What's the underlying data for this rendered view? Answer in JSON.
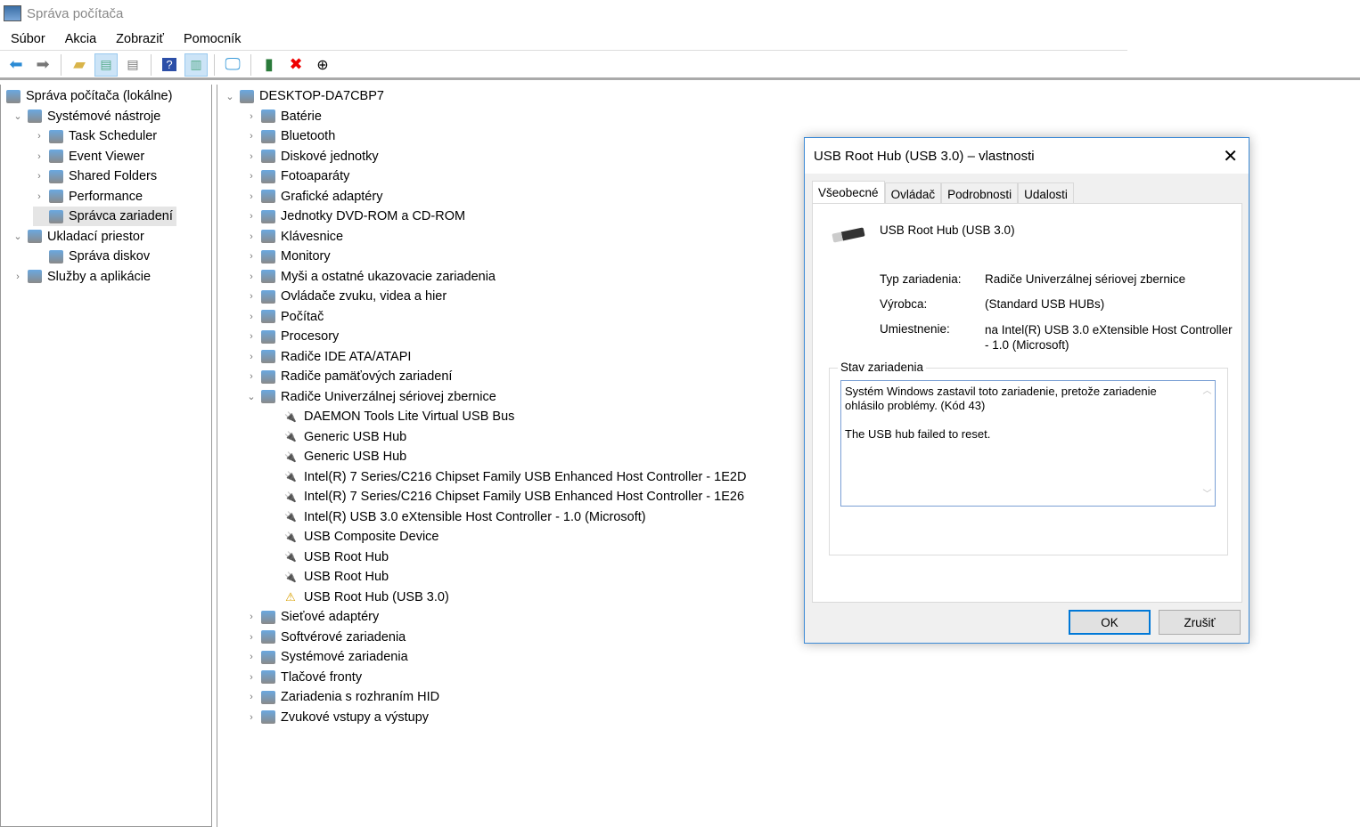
{
  "window": {
    "title": "Správa počítača"
  },
  "menu": [
    "Súbor",
    "Akcia",
    "Zobraziť",
    "Pomocník"
  ],
  "toolbar": [
    "back-icon",
    "forward-icon",
    "up-folder-icon",
    "show-hide-tree-icon",
    "properties-icon",
    "help-icon",
    "show-action-pane-icon",
    "monitor-icon",
    "update-driver-icon",
    "uninstall-icon",
    "disable-icon"
  ],
  "left_tree": [
    {
      "label": "Správa počítača (lokálne)",
      "level": 0,
      "chev": ""
    },
    {
      "label": "Systémové nástroje",
      "level": 1,
      "chev": "v"
    },
    {
      "label": "Task Scheduler",
      "level": 2,
      "chev": ">"
    },
    {
      "label": "Event Viewer",
      "level": 2,
      "chev": ">"
    },
    {
      "label": "Shared Folders",
      "level": 2,
      "chev": ">"
    },
    {
      "label": "Performance",
      "level": 2,
      "chev": ">"
    },
    {
      "label": "Správca zariadení",
      "level": 2,
      "chev": "",
      "selected": true
    },
    {
      "label": "Ukladací priestor",
      "level": 1,
      "chev": "v"
    },
    {
      "label": "Správa diskov",
      "level": 2,
      "chev": ""
    },
    {
      "label": "Služby a aplikácie",
      "level": 1,
      "chev": ">"
    }
  ],
  "device_tree": [
    {
      "label": "DESKTOP-DA7CBP7",
      "level": 0,
      "chev": "v"
    },
    {
      "label": "Batérie",
      "level": 1,
      "chev": ">"
    },
    {
      "label": "Bluetooth",
      "level": 1,
      "chev": ">"
    },
    {
      "label": "Diskové jednotky",
      "level": 1,
      "chev": ">"
    },
    {
      "label": "Fotoaparáty",
      "level": 1,
      "chev": ">"
    },
    {
      "label": "Grafické adaptéry",
      "level": 1,
      "chev": ">"
    },
    {
      "label": "Jednotky DVD-ROM a CD-ROM",
      "level": 1,
      "chev": ">"
    },
    {
      "label": "Klávesnice",
      "level": 1,
      "chev": ">"
    },
    {
      "label": "Monitory",
      "level": 1,
      "chev": ">"
    },
    {
      "label": "Myši a ostatné ukazovacie zariadenia",
      "level": 1,
      "chev": ">"
    },
    {
      "label": "Ovládače zvuku, videa a hier",
      "level": 1,
      "chev": ">"
    },
    {
      "label": "Počítač",
      "level": 1,
      "chev": ">"
    },
    {
      "label": "Procesory",
      "level": 1,
      "chev": ">"
    },
    {
      "label": "Radiče IDE ATA/ATAPI",
      "level": 1,
      "chev": ">"
    },
    {
      "label": "Radiče pamäťových zariadení",
      "level": 1,
      "chev": ">"
    },
    {
      "label": "Radiče Univerzálnej sériovej zbernice",
      "level": 1,
      "chev": "v"
    },
    {
      "label": "DAEMON Tools Lite Virtual USB Bus",
      "level": 2,
      "chev": ""
    },
    {
      "label": "Generic USB Hub",
      "level": 2,
      "chev": ""
    },
    {
      "label": "Generic USB Hub",
      "level": 2,
      "chev": ""
    },
    {
      "label": "Intel(R) 7 Series/C216 Chipset Family USB Enhanced Host Controller - 1E2D",
      "level": 2,
      "chev": ""
    },
    {
      "label": "Intel(R) 7 Series/C216 Chipset Family USB Enhanced Host Controller - 1E26",
      "level": 2,
      "chev": ""
    },
    {
      "label": "Intel(R) USB 3.0 eXtensible Host Controller - 1.0 (Microsoft)",
      "level": 2,
      "chev": ""
    },
    {
      "label": "USB Composite Device",
      "level": 2,
      "chev": ""
    },
    {
      "label": "USB Root Hub",
      "level": 2,
      "chev": ""
    },
    {
      "label": "USB Root Hub",
      "level": 2,
      "chev": ""
    },
    {
      "label": "USB Root Hub (USB 3.0)",
      "level": 2,
      "chev": "",
      "warning": true
    },
    {
      "label": "Sieťové adaptéry",
      "level": 1,
      "chev": ">"
    },
    {
      "label": "Softvérové zariadenia",
      "level": 1,
      "chev": ">"
    },
    {
      "label": "Systémové zariadenia",
      "level": 1,
      "chev": ">"
    },
    {
      "label": "Tlačové fronty",
      "level": 1,
      "chev": ">"
    },
    {
      "label": "Zariadenia s rozhraním HID",
      "level": 1,
      "chev": ">"
    },
    {
      "label": "Zvukové vstupy a výstupy",
      "level": 1,
      "chev": ">"
    }
  ],
  "dialog": {
    "title": "USB Root Hub (USB 3.0) – vlastnosti",
    "tabs": [
      "Všeobecné",
      "Ovládač",
      "Podrobnosti",
      "Udalosti"
    ],
    "device_name": "USB Root Hub (USB 3.0)",
    "type_label": "Typ zariadenia:",
    "type_value": "Radiče Univerzálnej sériovej zbernice",
    "maker_label": "Výrobca:",
    "maker_value": "(Standard USB HUBs)",
    "location_label": "Umiestnenie:",
    "location_value": "na Intel(R) USB 3.0 eXtensible Host Controller - 1.0 (Microsoft)",
    "status_group": "Stav zariadenia",
    "status_line1": "Systém Windows zastavil toto zariadenie, pretože zariadenie ohlásilo problémy. (Kód 43)",
    "status_line2": "The USB hub failed to reset.",
    "ok": "OK",
    "cancel": "Zrušiť"
  }
}
